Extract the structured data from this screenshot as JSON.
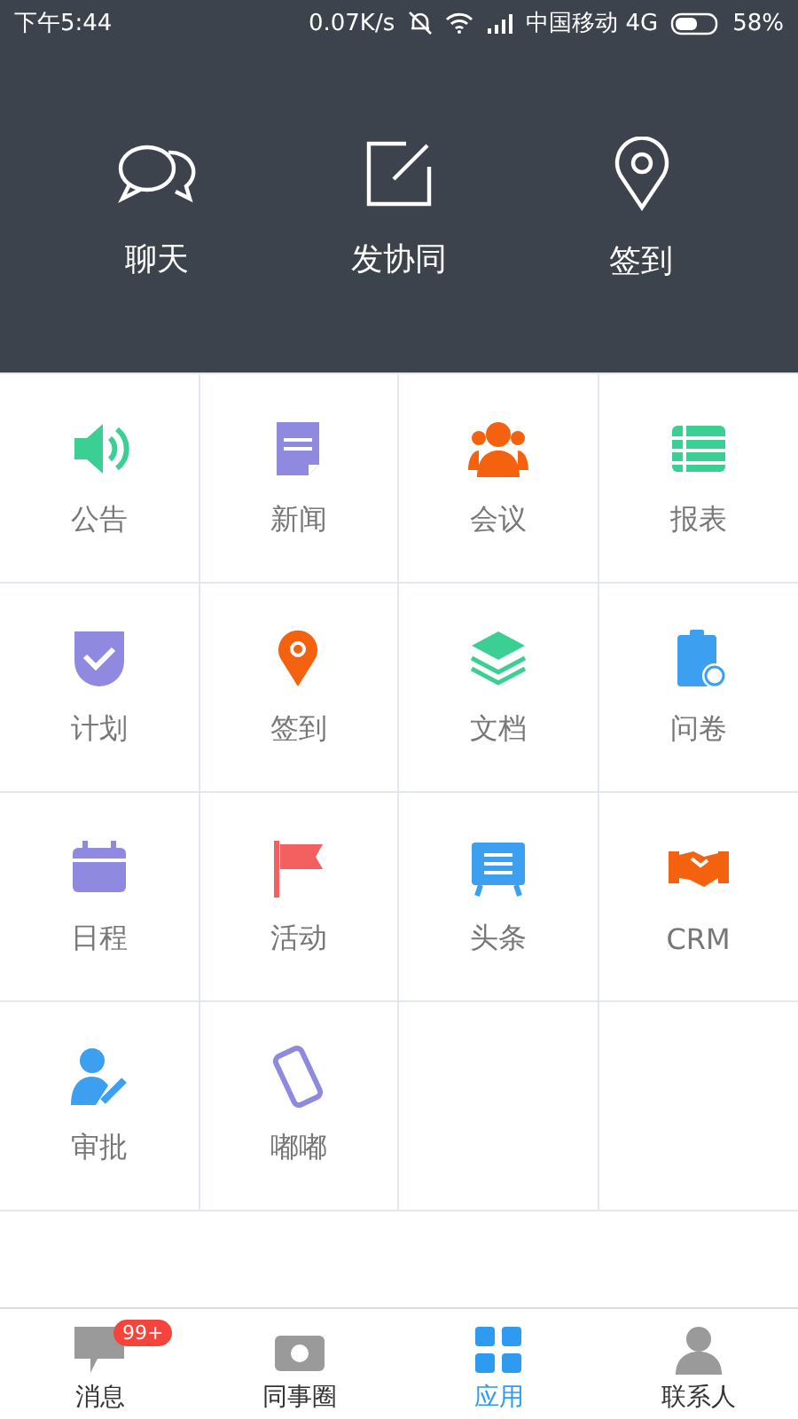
{
  "status_bar": {
    "time": "下午5:44",
    "speed": "0.07K/s",
    "carrier": "中国移动 4G",
    "battery": "58%"
  },
  "quick_actions": [
    {
      "kind": "chat",
      "label": "聊天"
    },
    {
      "kind": "edit",
      "label": "发协同"
    },
    {
      "kind": "pin",
      "label": "签到"
    }
  ],
  "apps": [
    {
      "kind": "speaker",
      "label": "公告",
      "color": "#3ccf94"
    },
    {
      "kind": "news",
      "label": "新闻",
      "color": "#8f8ae0"
    },
    {
      "kind": "people",
      "label": "会议",
      "color": "#f5620f"
    },
    {
      "kind": "table",
      "label": "报表",
      "color": "#3ccf94"
    },
    {
      "kind": "shield",
      "label": "计划",
      "color": "#8f8ae0"
    },
    {
      "kind": "pin",
      "label": "签到",
      "color": "#f5620f"
    },
    {
      "kind": "layers",
      "label": "文档",
      "color": "#3ccf94"
    },
    {
      "kind": "clipboard",
      "label": "问卷",
      "color": "#3d9ff0"
    },
    {
      "kind": "calendar",
      "label": "日程",
      "color": "#8f8ae0"
    },
    {
      "kind": "flag",
      "label": "活动",
      "color": "#f26060"
    },
    {
      "kind": "board",
      "label": "头条",
      "color": "#3d9ff0"
    },
    {
      "kind": "handshake",
      "label": "CRM",
      "color": "#f5620f"
    },
    {
      "kind": "person",
      "label": "审批",
      "color": "#3d9ff0"
    },
    {
      "kind": "phone",
      "label": "嘟嘟",
      "color": "#8f8ae0"
    }
  ],
  "tab_bar": [
    {
      "kind": "chat",
      "label": "消息",
      "badge": "99+",
      "selected": false
    },
    {
      "kind": "circle",
      "label": "同事圈",
      "selected": false
    },
    {
      "kind": "grid",
      "label": "应用",
      "selected": true
    },
    {
      "kind": "contacts",
      "label": "联系人",
      "selected": false
    }
  ]
}
